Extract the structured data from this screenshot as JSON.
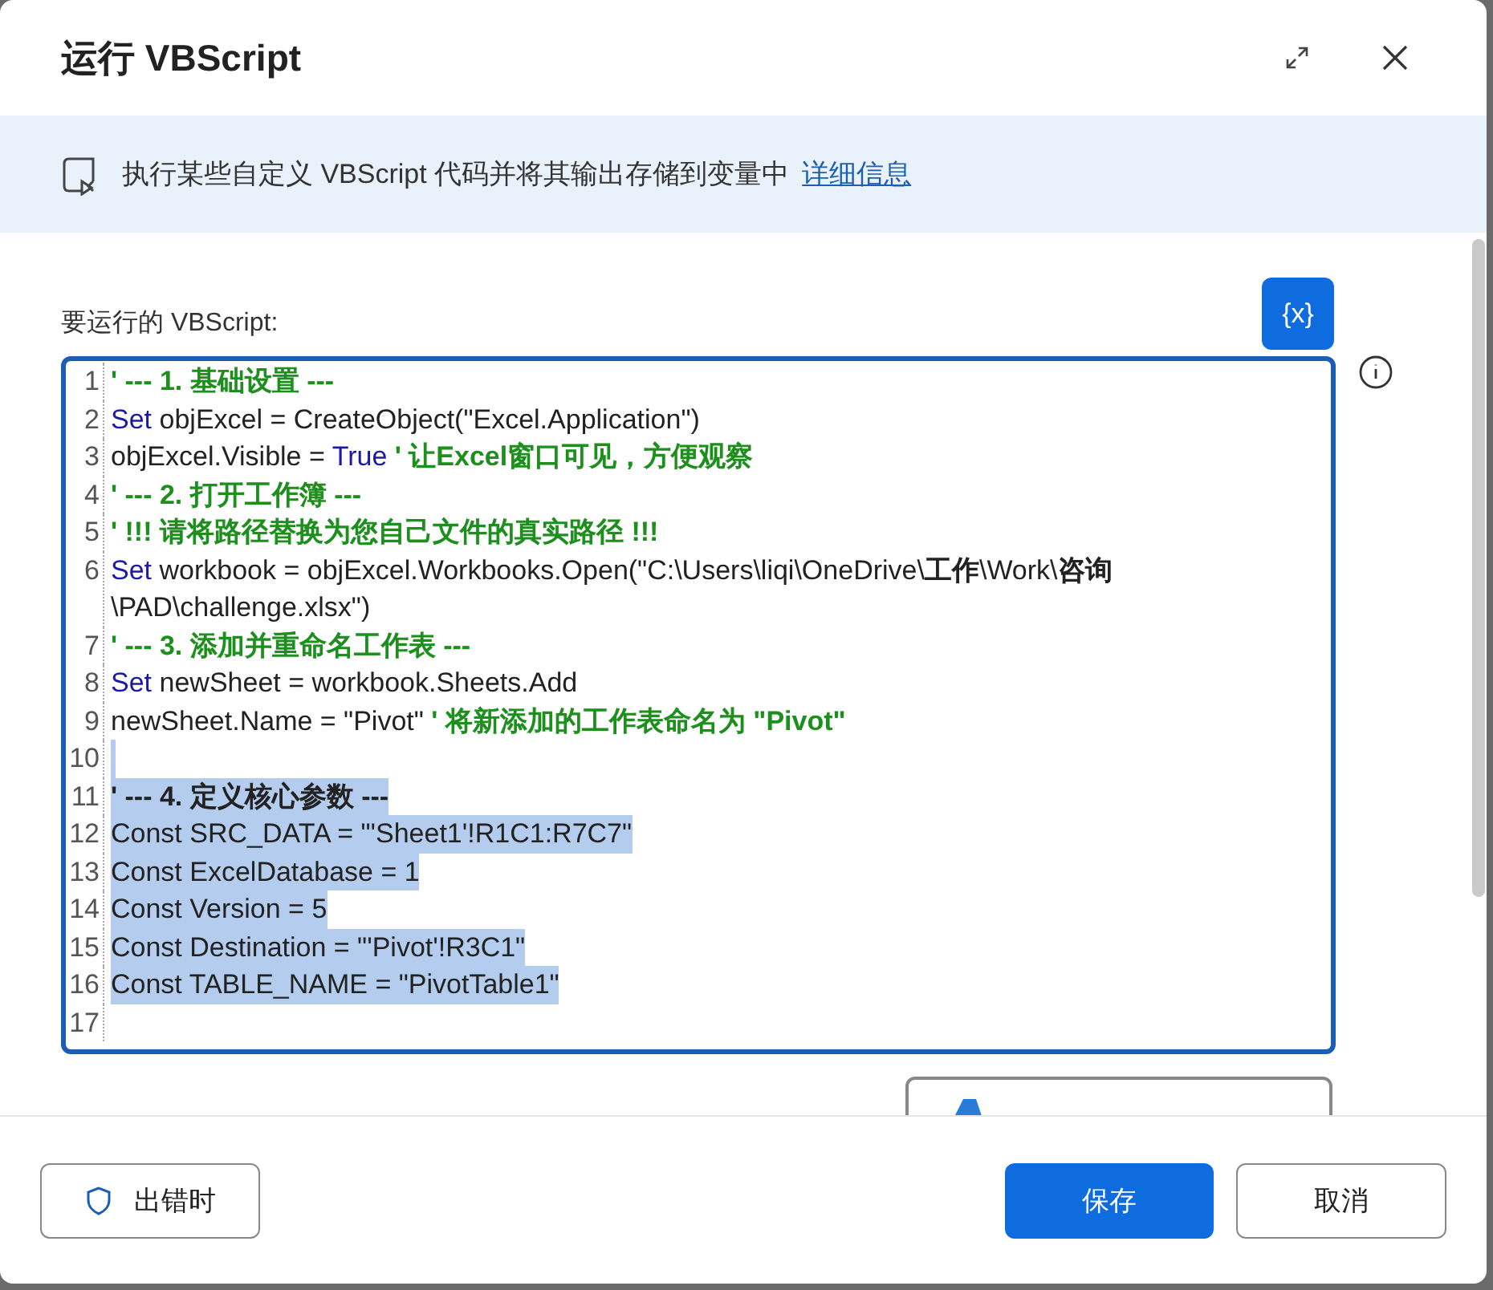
{
  "window": {
    "title": "运行 VBScript"
  },
  "banner": {
    "text": "执行某些自定义 VBScript 代码并将其输出存储到变量中",
    "link": "详细信息"
  },
  "field": {
    "label": "要运行的 VBScript:",
    "variable_button": "{x}"
  },
  "code_lines": [
    {
      "number": "1",
      "selected": false,
      "segments": [
        {
          "kind": "comment",
          "text": "' --- 1. 基础设置 ---"
        }
      ]
    },
    {
      "number": "2",
      "selected": false,
      "segments": [
        {
          "kind": "keyword",
          "text": "Set"
        },
        {
          "kind": "plain",
          "text": " objExcel = CreateObject(\"Excel.Application\")"
        }
      ]
    },
    {
      "number": "3",
      "selected": false,
      "segments": [
        {
          "kind": "plain",
          "text": "objExcel.Visible = "
        },
        {
          "kind": "keyword",
          "text": "True"
        },
        {
          "kind": "comment",
          "text": " ' 让Excel窗口可见，方便观察"
        }
      ]
    },
    {
      "number": "4",
      "selected": false,
      "segments": [
        {
          "kind": "comment",
          "text": "' --- 2. 打开工作簿 ---"
        }
      ]
    },
    {
      "number": "5",
      "selected": false,
      "segments": [
        {
          "kind": "comment",
          "text": "' !!! 请将路径替换为您自己文件的真实路径 !!!"
        }
      ]
    },
    {
      "number": "6",
      "selected": false,
      "segments": [
        {
          "kind": "keyword",
          "text": "Set"
        },
        {
          "kind": "plain",
          "text": " workbook = objExcel.Workbooks.Open(\"C:\\Users\\liqi\\OneDrive\\**工作**\\Work\\**咨询**\\PAD\\challenge.xlsx\")"
        }
      ]
    },
    {
      "number": "7",
      "selected": false,
      "segments": [
        {
          "kind": "comment",
          "text": "' --- 3. 添加并重命名工作表 ---"
        }
      ]
    },
    {
      "number": "8",
      "selected": false,
      "segments": [
        {
          "kind": "keyword",
          "text": "Set"
        },
        {
          "kind": "plain",
          "text": " newSheet = workbook.Sheets.Add"
        }
      ]
    },
    {
      "number": "9",
      "selected": false,
      "segments": [
        {
          "kind": "plain",
          "text": "newSheet.Name = \"Pivot\""
        },
        {
          "kind": "comment",
          "text": " ' 将新添加的工作表命名为 \"Pivot\""
        }
      ]
    },
    {
      "number": "10",
      "selected": true
    },
    {
      "number": "11",
      "selected": true,
      "segments": [
        {
          "kind": "comment",
          "text": "' --- 4. 定义核心参数 ---"
        }
      ]
    },
    {
      "number": "12",
      "selected": true,
      "segments": [
        {
          "kind": "plain",
          "text": "Const SRC_DATA = \"'Sheet1'!R1C1:R7C7\""
        }
      ]
    },
    {
      "number": "13",
      "selected": true,
      "segments": [
        {
          "kind": "plain",
          "text": "Const ExcelDatabase = 1"
        }
      ]
    },
    {
      "number": "14",
      "selected": true,
      "segments": [
        {
          "kind": "plain",
          "text": "Const Version = 5"
        }
      ]
    },
    {
      "number": "15",
      "selected": true,
      "segments": [
        {
          "kind": "plain",
          "text": "Const Destination = \"'Pivot'!R3C1\""
        }
      ]
    },
    {
      "number": "16",
      "selected": true,
      "segments": [
        {
          "kind": "plain",
          "text": "Const TABLE_NAME = \"PivotTable1\""
        }
      ]
    },
    {
      "number": "17",
      "selected": false
    }
  ],
  "footer": {
    "error_button": "出错时",
    "save_button": "保存",
    "cancel_button": "取消"
  }
}
